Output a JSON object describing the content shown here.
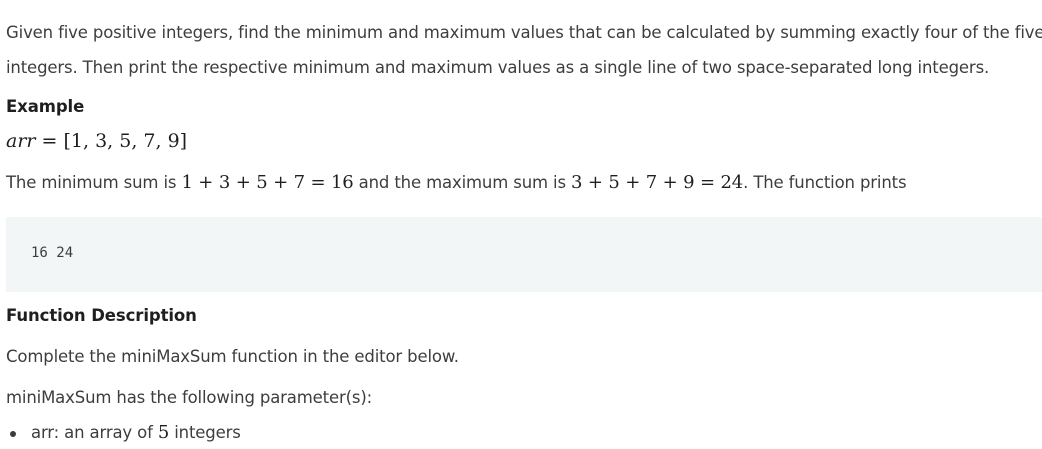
{
  "intro": {
    "line1": "Given five positive integers, find the minimum and maximum values that can be calculated by summing exactly four of the five",
    "line2": "integers. Then print the respective minimum and maximum values as a single line of two space-separated long integers."
  },
  "example": {
    "heading": "Example",
    "arr_var": "arr",
    "arr_eq": " = ",
    "arr_value": "[1, 3, 5, 7, 9]",
    "sum_prefix": "The minimum sum is ",
    "min_expr": "1 + 3 + 5 + 7 = 16",
    "sum_middle": " and the maximum sum is ",
    "max_expr": "3 + 5 + 7 + 9 = 24",
    "sum_suffix": ". The function prints",
    "output": "16 24"
  },
  "function_description": {
    "heading": "Function Description",
    "complete_text": "Complete the miniMaxSum function in the editor below.",
    "params_text": "miniMaxSum has the following parameter(s):",
    "params": [
      {
        "prefix": "arr: an array of ",
        "count": "5",
        "suffix": " integers"
      }
    ]
  }
}
